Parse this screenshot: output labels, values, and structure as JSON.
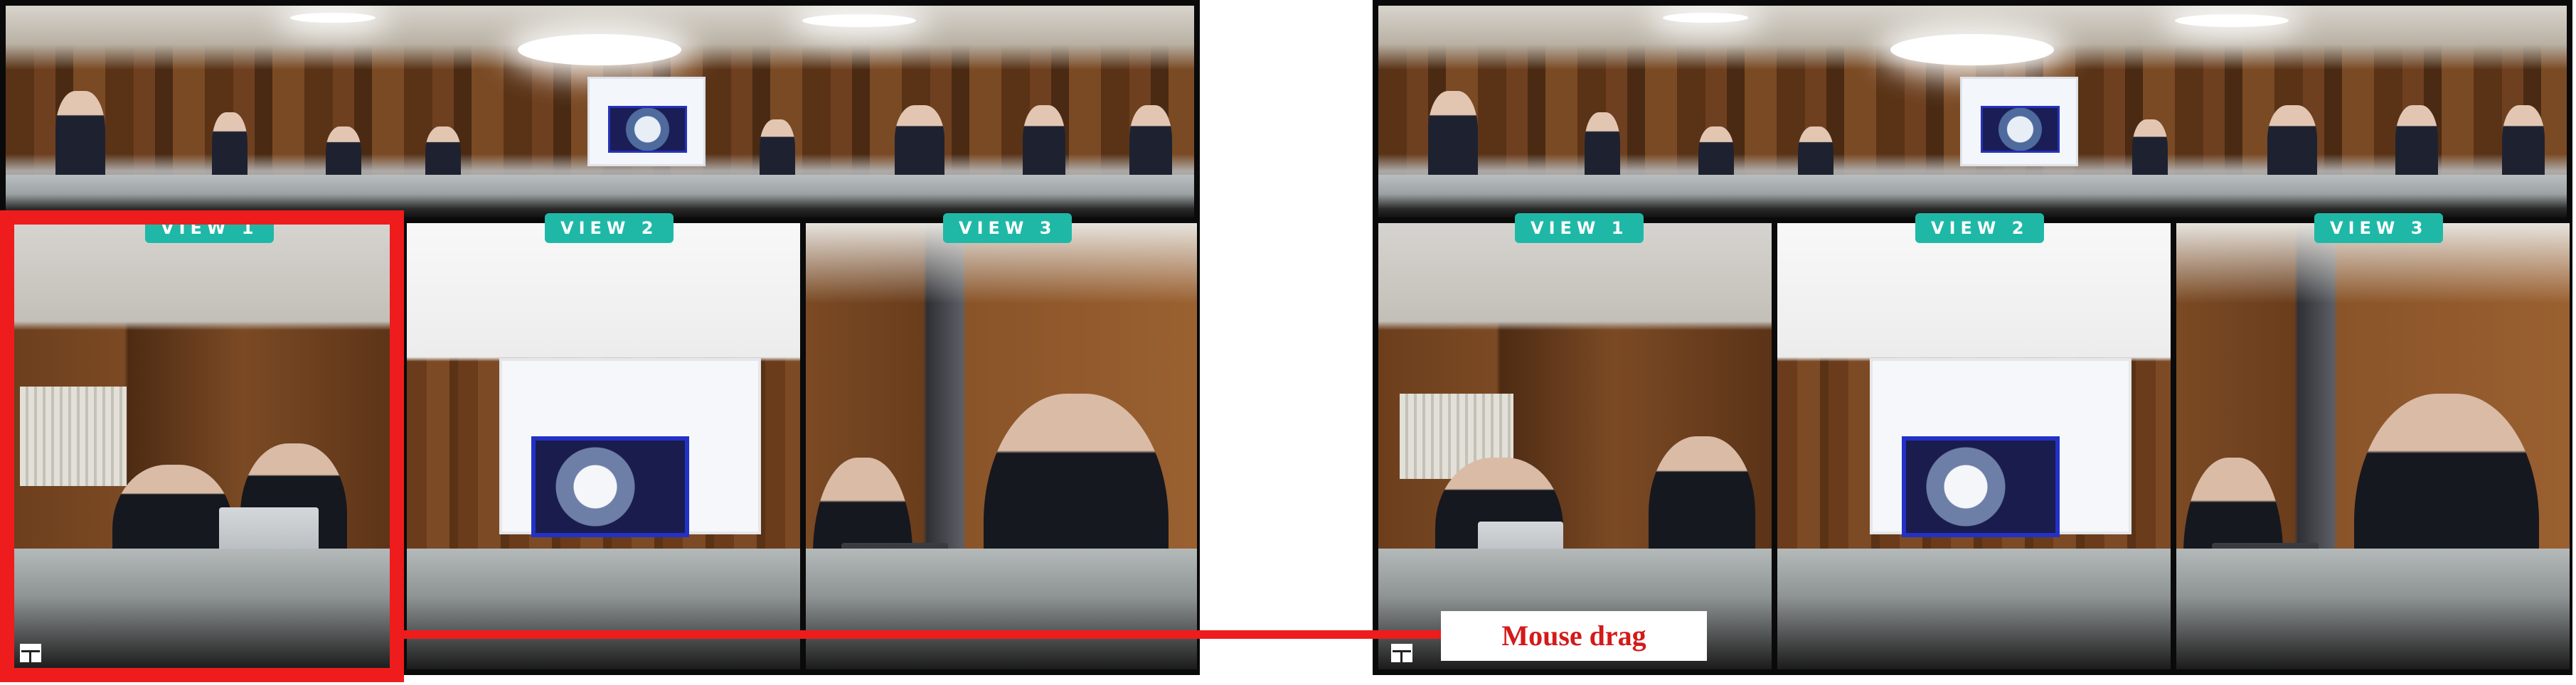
{
  "views": {
    "left": [
      "VIEW 1",
      "VIEW 2",
      "VIEW 3"
    ],
    "right": [
      "VIEW 1",
      "VIEW 2",
      "VIEW 3"
    ]
  },
  "annotation": {
    "drag_label": "Mouse drag",
    "highlight_color": "#ee1c1c"
  },
  "icons": {
    "layout": "layout-grid-icon"
  },
  "colors": {
    "view_badge": "#1fb8a7",
    "frame": "#0a0a0a"
  }
}
